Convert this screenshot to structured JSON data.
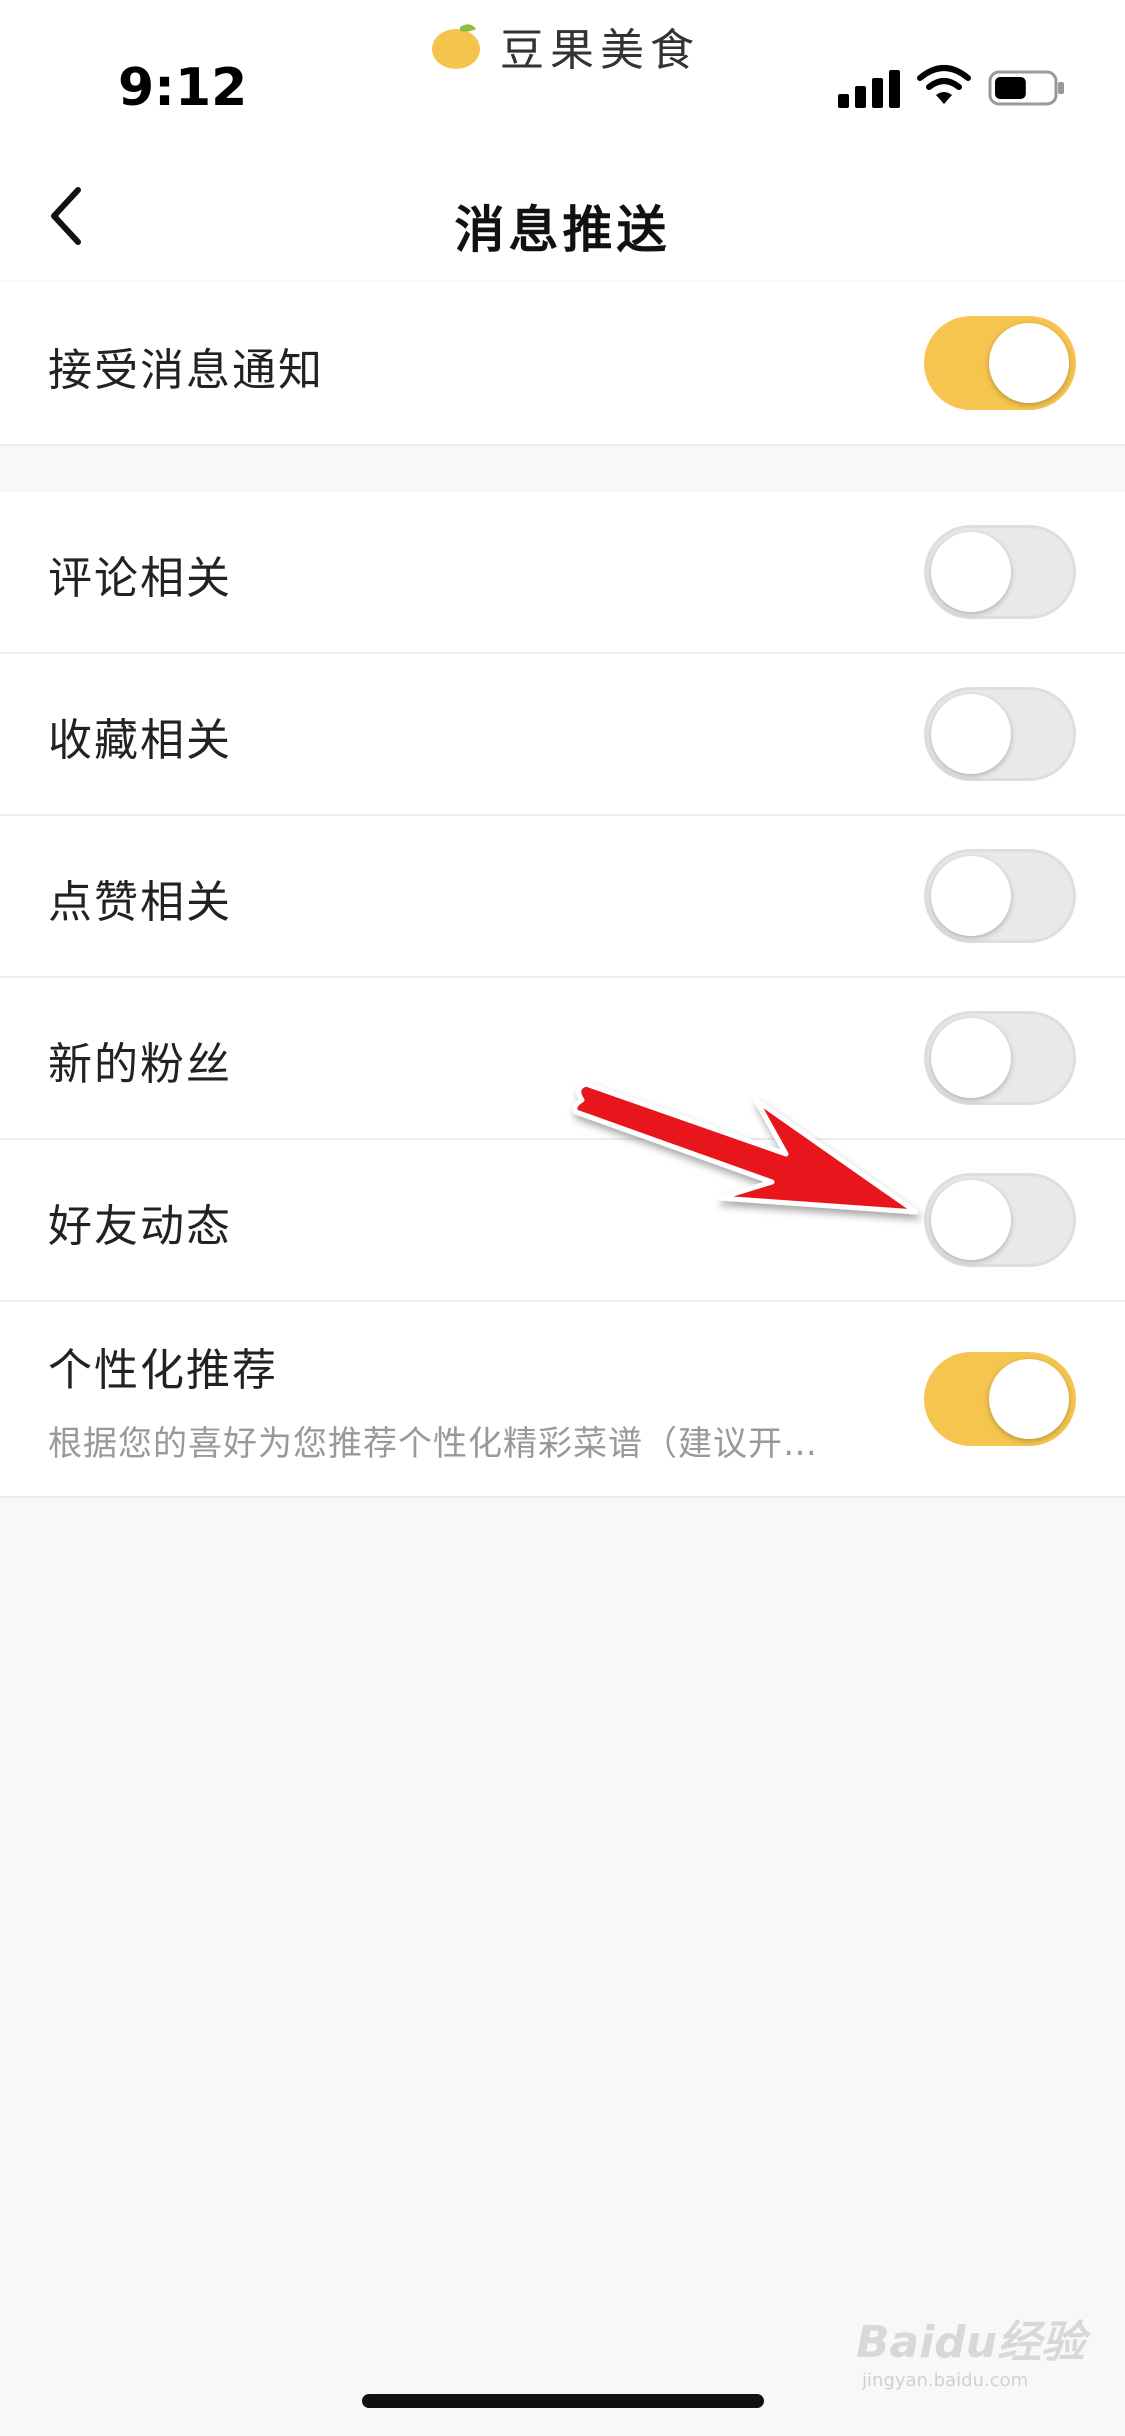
{
  "status_bar": {
    "app_name": "豆果美食",
    "time": "9:12",
    "signal_icon": "signal-icon",
    "wifi_icon": "wifi-icon",
    "battery_icon": "battery-icon",
    "battery_level": 0.55
  },
  "nav": {
    "back_icon": "chevron-left-icon",
    "title": "消息推送"
  },
  "settings": {
    "master": {
      "label": "接受消息通知",
      "on": true
    },
    "items": [
      {
        "label": "评论相关",
        "on": false
      },
      {
        "label": "收藏相关",
        "on": false
      },
      {
        "label": "点赞相关",
        "on": false
      },
      {
        "label": "新的粉丝",
        "on": false
      },
      {
        "label": "好友动态",
        "on": false
      }
    ],
    "personalized": {
      "label": "个性化推荐",
      "description": "根据您的喜好为您推荐个性化精彩菜谱（建议开…",
      "on": true
    }
  },
  "colors": {
    "toggle_on": "#f5c54f",
    "toggle_off": "#e9e9e9",
    "annotation_arrow": "#e8151b"
  },
  "watermark": {
    "text": "Baidu经验",
    "sub": "jingyan.baidu.com"
  }
}
